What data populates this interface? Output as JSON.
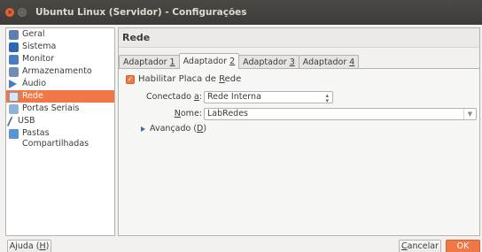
{
  "window": {
    "title": "Ubuntu Linux (Servidor) - Configurações"
  },
  "sidebar": {
    "items": [
      {
        "label": "Geral",
        "icon": "general-icon"
      },
      {
        "label": "Sistema",
        "icon": "system-icon"
      },
      {
        "label": "Monitor",
        "icon": "monitor-icon"
      },
      {
        "label": "Armazenamento",
        "icon": "storage-icon"
      },
      {
        "label": "Áudio",
        "icon": "audio-icon"
      },
      {
        "label": "Rede",
        "icon": "network-icon",
        "selected": true
      },
      {
        "label": "Portas Seriais",
        "icon": "serial-ports-icon"
      },
      {
        "label": "USB",
        "icon": "usb-icon"
      },
      {
        "label": "Pastas Compartilhadas",
        "icon": "shared-folders-icon"
      }
    ]
  },
  "main": {
    "header": "Rede",
    "tabs": [
      {
        "prefix": "Adaptador ",
        "mnemonic": "1"
      },
      {
        "prefix": "Adaptador ",
        "mnemonic": "2",
        "active": true
      },
      {
        "prefix": "Adaptador ",
        "mnemonic": "3"
      },
      {
        "prefix": "Adaptador ",
        "mnemonic": "4"
      }
    ],
    "enable": {
      "before": "Habilitar Placa de ",
      "mnemonic": "R",
      "after": "ede",
      "checked": true
    },
    "attached": {
      "before": "Conectado ",
      "mnemonic": "a",
      "after": ":",
      "value": "Rede Interna"
    },
    "name": {
      "mnemonic": "N",
      "after": "ome:",
      "value": "LabRedes"
    },
    "advanced": {
      "before": "Avançado (",
      "mnemonic": "D",
      "after": ")"
    }
  },
  "footer": {
    "help": {
      "before": "Ajuda (",
      "mnemonic": "H",
      "after": ")"
    },
    "cancel": {
      "mnemonic": "C",
      "after": "ancelar"
    },
    "ok": "OK"
  },
  "colors": {
    "accent": "#f07746",
    "titlebar": "#3c3b37",
    "background": "#f2f1f0"
  }
}
